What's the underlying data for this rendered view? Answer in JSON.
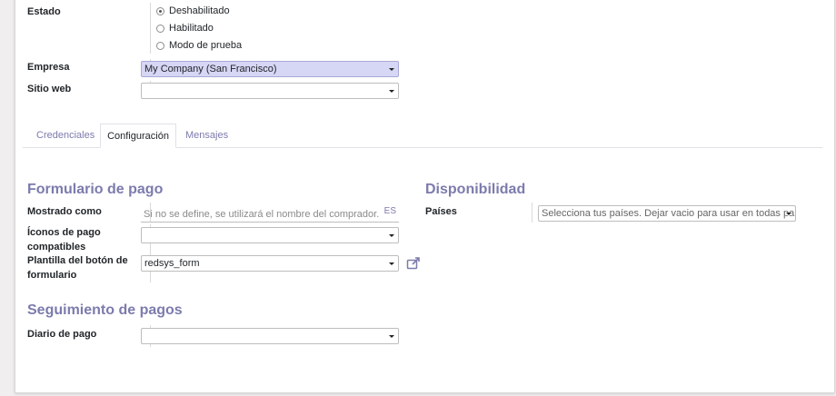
{
  "header_fields": {
    "estado": {
      "label": "Estado",
      "options": [
        {
          "label": "Deshabilitado",
          "selected": true
        },
        {
          "label": "Habilitado",
          "selected": false
        },
        {
          "label": "Modo de prueba",
          "selected": false
        }
      ]
    },
    "empresa": {
      "label": "Empresa",
      "value": "My Company (San Francisco)"
    },
    "sitio_web": {
      "label": "Sitio web",
      "value": ""
    }
  },
  "tabs": [
    {
      "label": "Credenciales",
      "active": false
    },
    {
      "label": "Configuración",
      "active": true
    },
    {
      "label": "Mensajes",
      "active": false
    }
  ],
  "formulario": {
    "title": "Formulario de pago",
    "mostrado_como": {
      "label": "Mostrado como",
      "placeholder": "Si no se define, se utilizará el nombre del comprador.",
      "lang_badge": "ES"
    },
    "iconos": {
      "label_line1": "Íconos de pago",
      "label_line2": "compatibles",
      "value": ""
    },
    "plantilla": {
      "label_line1": "Plantilla del botón de",
      "label_line2": "formulario",
      "value": "redsys_form",
      "link_icon": "external-link-icon"
    }
  },
  "disponibilidad": {
    "title": "Disponibilidad",
    "paises": {
      "label": "Países",
      "placeholder": "Selecciona tus países. Dejar vacio para usar en todas par"
    }
  },
  "seguimiento": {
    "title": "Seguimiento de pagos",
    "diario": {
      "label": "Diario de pago",
      "value": ""
    }
  },
  "colors": {
    "accent": "#7c7bad",
    "selected_bg": "#d6d6f5"
  }
}
